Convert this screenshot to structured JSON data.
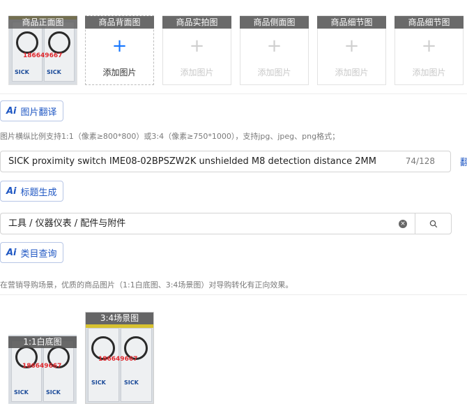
{
  "image_slots": [
    {
      "caption": "商品正面图",
      "has_image": true
    },
    {
      "caption": "商品背面图",
      "add_label": "添加图片"
    },
    {
      "caption": "商品实拍图",
      "add_label": "添加图片"
    },
    {
      "caption": "商品侧面图",
      "add_label": "添加图片"
    },
    {
      "caption": "商品细节图",
      "add_label": "添加图片"
    },
    {
      "caption": "商品细节图",
      "add_label": "添加图片"
    }
  ],
  "plus_glyph": "+",
  "translate_button": {
    "ai": "Ai",
    "label": "图片翻译"
  },
  "image_hint": "图片横纵比例支持1:1（像素≥800*800）或3:4（像素≥750*1000），支持jpg、jpeg、png格式；",
  "title_field": {
    "value": "SICK proximity switch IME08-02BPSZW2K unshielded M8 detection distance 2MM",
    "counter": "74/128"
  },
  "overflow_char": "翻",
  "title_button": {
    "ai": "Ai",
    "label": "标题生成"
  },
  "category_field": {
    "value": "工具 / 仪器仪表 / 配件与附件"
  },
  "clear_glyph": "×",
  "category_button": {
    "ai": "Ai",
    "label": "类目查询"
  },
  "marketing_hint": "在营销导购场景，优质的商品图片（1:1白底图、3:4场景图）对导购转化有正向效果。",
  "marketing_images": [
    {
      "caption": "1:1白底图"
    },
    {
      "caption": "3:4场景图"
    }
  ],
  "photo_stamp": "186649667",
  "photo_brand": "SICK",
  "colors": {
    "accent": "#1f57c3",
    "caption_bg": "#6a6a6a"
  }
}
